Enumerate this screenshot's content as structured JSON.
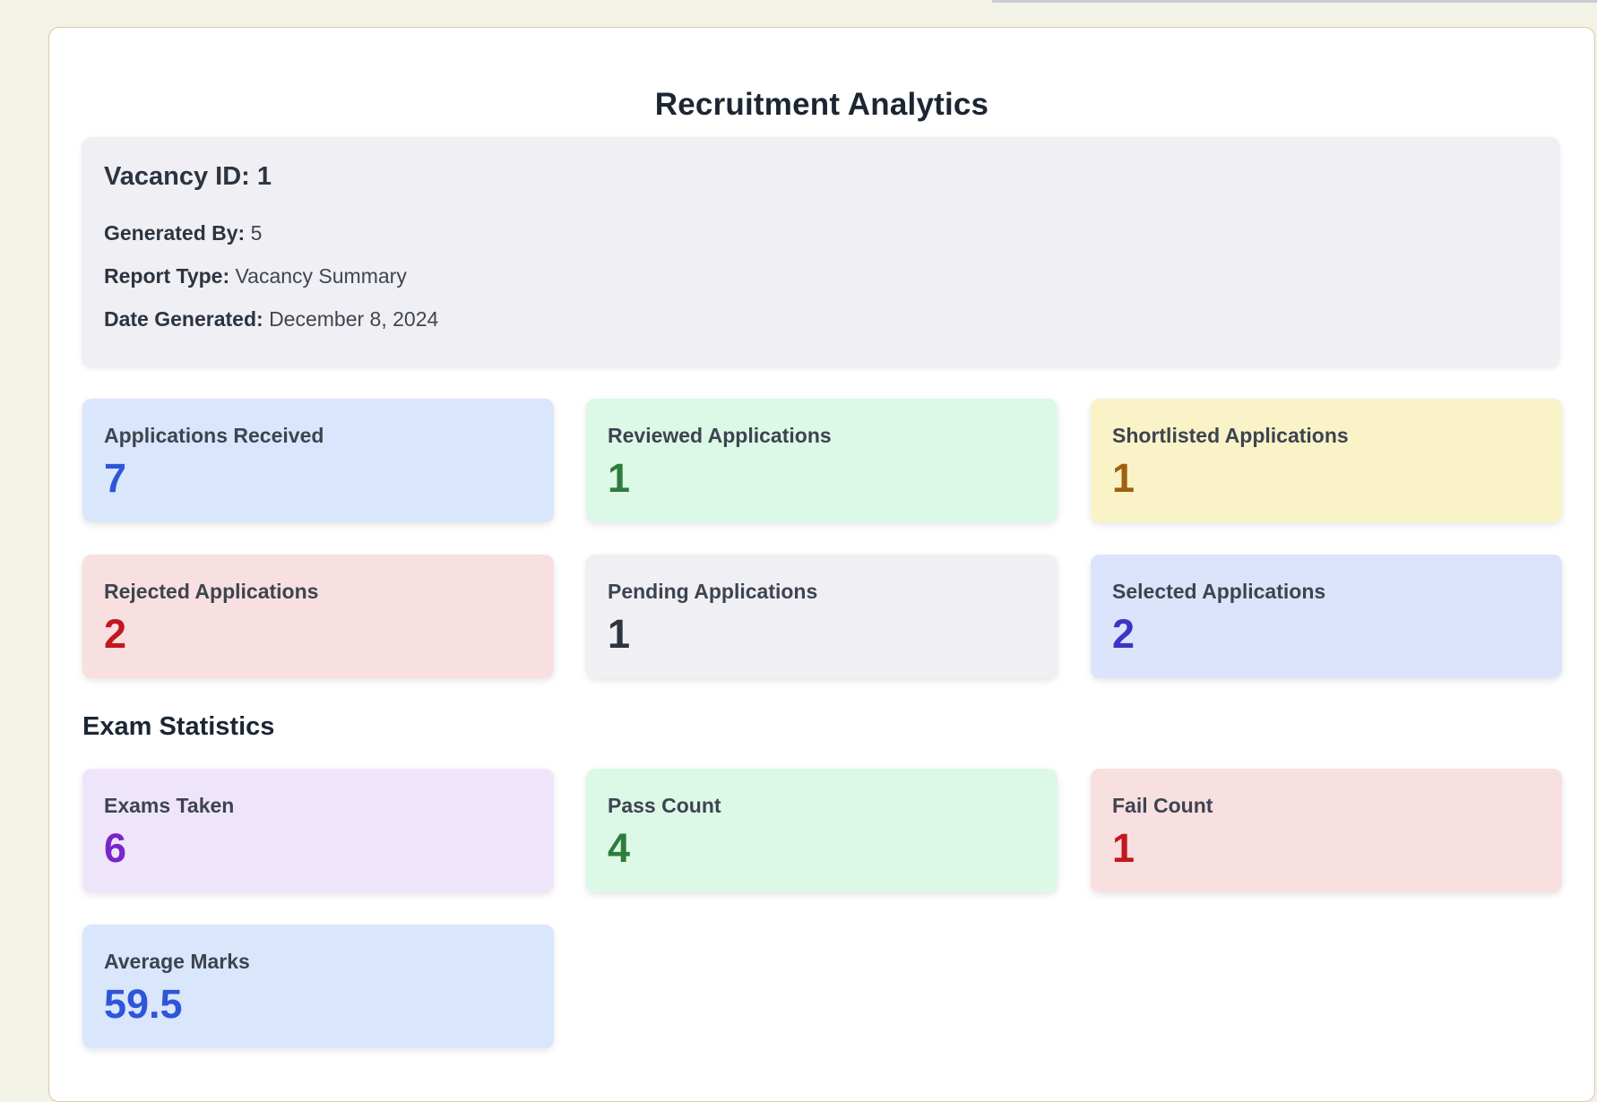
{
  "report": {
    "title": "Recruitment Analytics",
    "vacancy_heading": "Vacancy ID: 1",
    "generated_by": {
      "label": "Generated By:",
      "value": "5"
    },
    "report_type": {
      "label": "Report Type:",
      "value": "Vacancy Summary"
    },
    "date_generated": {
      "label": "Date Generated:",
      "value": "December 8, 2024"
    }
  },
  "applications": [
    {
      "label": "Applications Received",
      "value": "7",
      "bg": "#d9e6fb",
      "color": "#2f55d9"
    },
    {
      "label": "Reviewed Applications",
      "value": "1",
      "bg": "#dcf8e7",
      "color": "#2d7d3c"
    },
    {
      "label": "Shortlisted Applications",
      "value": "1",
      "bg": "#faf3c8",
      "color": "#a0600f"
    },
    {
      "label": "Rejected Applications",
      "value": "2",
      "bg": "#f8dfe0",
      "color": "#c0191f"
    },
    {
      "label": "Pending Applications",
      "value": "1",
      "bg": "#f0f0f4",
      "color": "#2c3440"
    },
    {
      "label": "Selected Applications",
      "value": "2",
      "bg": "#dce4fb",
      "color": "#3b35c4"
    }
  ],
  "exam_section_heading": "Exam Statistics",
  "exams": [
    {
      "label": "Exams Taken",
      "value": "6",
      "bg": "#efe5fb",
      "color": "#7a25c9"
    },
    {
      "label": "Pass Count",
      "value": "4",
      "bg": "#dcf8e7",
      "color": "#2d7d3c"
    },
    {
      "label": "Fail Count",
      "value": "1",
      "bg": "#f8dfe0",
      "color": "#c0191f"
    },
    {
      "label": "Average Marks",
      "value": "59.5",
      "bg": "#d9e6fb",
      "color": "#2f55d9"
    }
  ]
}
